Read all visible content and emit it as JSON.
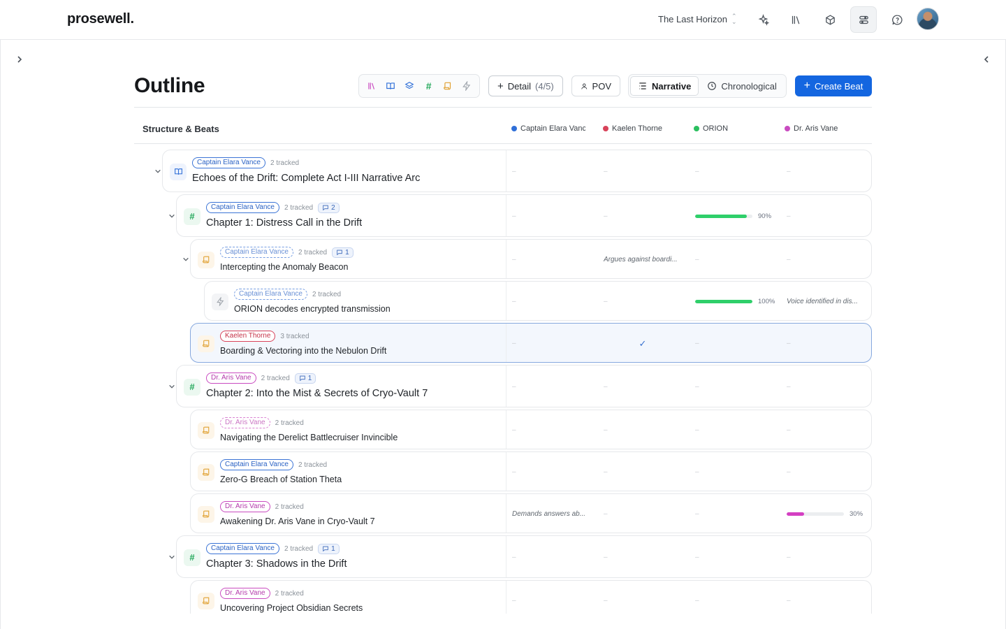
{
  "app": {
    "logo": "prosewell.",
    "project": "The Last Horizon"
  },
  "toolbar": {
    "page_title": "Outline",
    "detail_label": "Detail",
    "detail_count": "(4/5)",
    "pov_label": "POV",
    "narrative_label": "Narrative",
    "chronological_label": "Chronological",
    "create_label": "Create Beat"
  },
  "columns": {
    "structure_label": "Structure & Beats",
    "characters": [
      {
        "name": "Captain Elara Vanc",
        "color": "#2f6fd8"
      },
      {
        "name": "Kaelen Thorne",
        "color": "#d8435a"
      },
      {
        "name": "ORION",
        "color": "#2bbf5f"
      },
      {
        "name": "Dr. Aris Vane",
        "color": "#c94bc0"
      }
    ]
  },
  "rows": [
    {
      "kind": "act",
      "pill": "Captain Elara Vance",
      "tracked": "2 tracked",
      "comments": "",
      "title": "Echoes of the Drift: Complete Act I-III Narrative Arc",
      "cells": [
        {
          "t": "dash",
          "v": "–"
        },
        {
          "t": "dash",
          "v": "–"
        },
        {
          "t": "dash",
          "v": "–"
        },
        {
          "t": "dash",
          "v": "–"
        }
      ]
    },
    {
      "kind": "chapter",
      "pill": "Captain Elara Vance",
      "tracked": "2 tracked",
      "comments": "2",
      "title": "Chapter 1: Distress Call in the Drift",
      "cells": [
        {
          "t": "dash",
          "v": "–"
        },
        {
          "t": "dash",
          "v": "–"
        },
        {
          "t": "bar",
          "v": "90%",
          "p": 0.9,
          "c": "#2fcf6a"
        },
        {
          "t": "dash",
          "v": "–"
        }
      ]
    },
    {
      "kind": "scene",
      "pill": "Captain Elara Vance",
      "tracked": "2 tracked",
      "comments": "1",
      "title": "Intercepting the Anomaly Beacon",
      "cells": [
        {
          "t": "dash",
          "v": "–"
        },
        {
          "t": "note",
          "v": "Argues against boardi..."
        },
        {
          "t": "dash",
          "v": "–"
        },
        {
          "t": "dash",
          "v": "–"
        }
      ]
    },
    {
      "kind": "beat",
      "pill": "Captain Elara Vance",
      "tracked": "2 tracked",
      "comments": "",
      "title": "ORION decodes encrypted transmission",
      "cells": [
        {
          "t": "dash",
          "v": "–"
        },
        {
          "t": "dash",
          "v": "–"
        },
        {
          "t": "bar",
          "v": "100%",
          "p": 1.0,
          "c": "#2fcf6a"
        },
        {
          "t": "note",
          "v": "Voice identified in dis..."
        }
      ]
    },
    {
      "kind": "scene",
      "pill": "Kaelen Thorne",
      "tracked": "3 tracked",
      "comments": "",
      "title": "Boarding & Vectoring into the Nebulon Drift",
      "cells": [
        {
          "t": "dash",
          "v": "–"
        },
        {
          "t": "check",
          "v": "✓"
        },
        {
          "t": "dash",
          "v": "–"
        },
        {
          "t": "dash",
          "v": "–"
        }
      ]
    },
    {
      "kind": "chapter",
      "pill": "Dr. Aris Vane",
      "tracked": "2 tracked",
      "comments": "1",
      "title": "Chapter 2: Into the Mist & Secrets of Cryo-Vault 7",
      "cells": [
        {
          "t": "dash",
          "v": "–"
        },
        {
          "t": "dash",
          "v": "–"
        },
        {
          "t": "dash",
          "v": "–"
        },
        {
          "t": "dash",
          "v": "–"
        }
      ]
    },
    {
      "kind": "scene",
      "pill": "Dr. Aris Vane",
      "tracked": "2 tracked",
      "comments": "",
      "title": "Navigating the Derelict Battlecruiser Invincible",
      "cells": [
        {
          "t": "dash",
          "v": "–"
        },
        {
          "t": "dash",
          "v": "–"
        },
        {
          "t": "dash",
          "v": "–"
        },
        {
          "t": "dash",
          "v": "–"
        }
      ]
    },
    {
      "kind": "scene",
      "pill": "Captain Elara Vance",
      "tracked": "2 tracked",
      "comments": "",
      "title": "Zero-G Breach of Station Theta",
      "cells": [
        {
          "t": "dash",
          "v": "–"
        },
        {
          "t": "dash",
          "v": "–"
        },
        {
          "t": "dash",
          "v": "–"
        },
        {
          "t": "dash",
          "v": "–"
        }
      ]
    },
    {
      "kind": "scene",
      "pill": "Dr. Aris Vane",
      "tracked": "2 tracked",
      "comments": "",
      "title": "Awakening Dr. Aris Vane in Cryo-Vault 7",
      "cells": [
        {
          "t": "note",
          "v": "Demands answers ab..."
        },
        {
          "t": "dash",
          "v": "–"
        },
        {
          "t": "dash",
          "v": "–"
        },
        {
          "t": "bar",
          "v": "30%",
          "p": 0.3,
          "c": "#d43fc2"
        }
      ]
    },
    {
      "kind": "chapter",
      "pill": "Captain Elara Vance",
      "tracked": "2 tracked",
      "comments": "1",
      "title": "Chapter 3: Shadows in the Drift",
      "cells": [
        {
          "t": "dash",
          "v": "–"
        },
        {
          "t": "dash",
          "v": "–"
        },
        {
          "t": "dash",
          "v": "–"
        },
        {
          "t": "dash",
          "v": "–"
        }
      ]
    },
    {
      "kind": "scene",
      "pill": "Dr. Aris Vane",
      "tracked": "2 tracked",
      "comments": "",
      "title": "Uncovering Project Obsidian Secrets",
      "cells": [
        {
          "t": "dash",
          "v": "–"
        },
        {
          "t": "dash",
          "v": "–"
        },
        {
          "t": "dash",
          "v": "–"
        },
        {
          "t": "dash",
          "v": "–"
        }
      ]
    }
  ]
}
